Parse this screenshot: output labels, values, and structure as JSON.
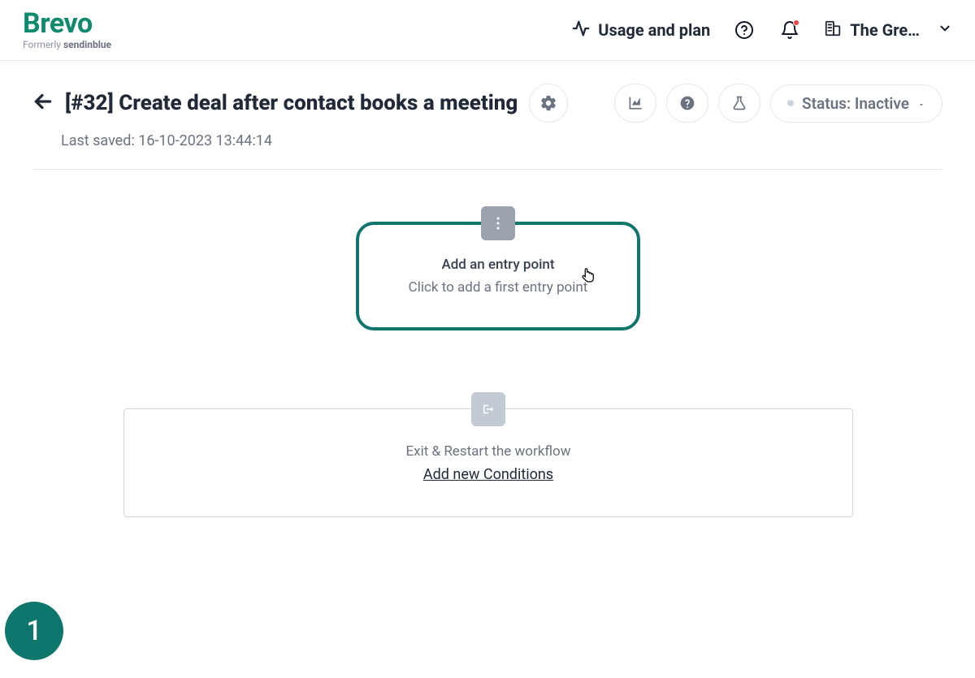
{
  "brand": {
    "name": "Brevo",
    "tagline_prefix": "Formerly ",
    "tagline_bold": "sendinblue"
  },
  "header": {
    "usage_plan": "Usage and plan",
    "account_name": "The Gre…"
  },
  "page": {
    "title": "[#32] Create deal after contact books a meeting",
    "last_saved": "Last saved: 16-10-2023 13:44:14",
    "status_label": "Status: Inactive"
  },
  "entry_card": {
    "title": "Add an entry point",
    "subtitle": "Click to add a first entry point"
  },
  "exit_card": {
    "title": "Exit & Restart the workflow",
    "link": "Add new Conditions"
  },
  "step_badge": "1",
  "colors": {
    "brand": "#0f8a6f",
    "teal_dark": "#0f766e"
  }
}
